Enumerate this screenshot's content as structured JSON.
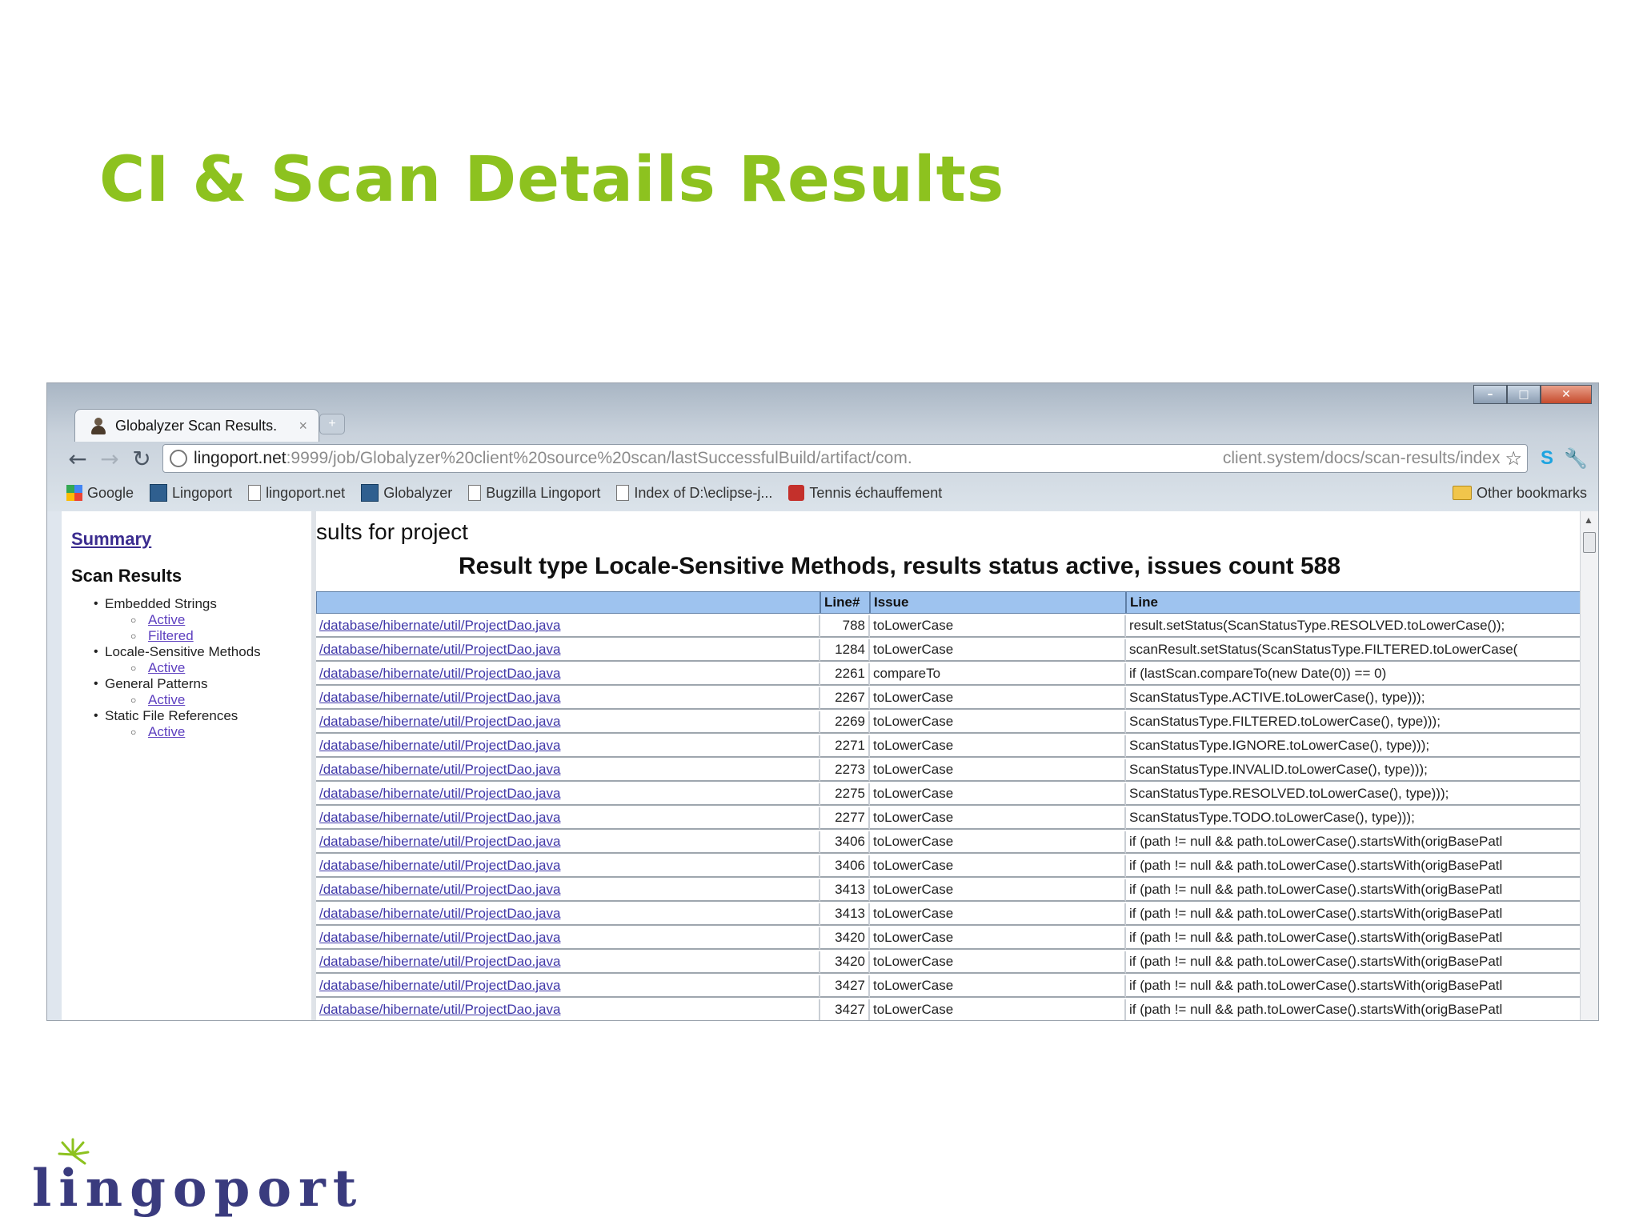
{
  "slide": {
    "title": "CI & Scan Details Results"
  },
  "browser": {
    "tab_title": "Globalyzer Scan Results.",
    "tab_close": "×",
    "new_tab": "+",
    "url_host": "lingoport.net",
    "url_path": ":9999/job/Globalyzer%20client%20source%20scan/lastSuccessfulBuild/artifact/com.",
    "url_tail": "client.system/docs/scan-results/index",
    "bookmarks": [
      {
        "label": "Google",
        "icon": "google-icon"
      },
      {
        "label": "Lingoport",
        "icon": "globalyzer-icon"
      },
      {
        "label": "lingoport.net",
        "icon": "page-icon"
      },
      {
        "label": "Globalyzer",
        "icon": "globalyzer-icon"
      },
      {
        "label": "Bugzilla Lingoport",
        "icon": "page-icon"
      },
      {
        "label": "Index of D:\\eclipse-j...",
        "icon": "page-icon"
      },
      {
        "label": "Tennis échauffement",
        "icon": "youtube-icon"
      }
    ],
    "other_bookmarks": "Other bookmarks"
  },
  "sidebar": {
    "summary": "Summary",
    "heading": "Scan Results",
    "categories": [
      {
        "label": "Embedded Strings",
        "links": [
          "Active",
          "Filtered"
        ]
      },
      {
        "label": "Locale-Sensitive Methods",
        "links": [
          "Active"
        ]
      },
      {
        "label": "General Patterns",
        "links": [
          "Active"
        ]
      },
      {
        "label": "Static File References",
        "links": [
          "Active"
        ]
      }
    ]
  },
  "main": {
    "results_for": "sults for project",
    "result_type": "Result type Locale-Sensitive Methods, results status active, issues count 588",
    "columns": [
      "",
      "Line#",
      "Issue",
      "Line"
    ],
    "rows": [
      {
        "file": "/database/hibernate/util/ProjectDao.java",
        "line": "788",
        "issue": "toLowerCase",
        "code": "result.setStatus(ScanStatusType.RESOLVED.toLowerCase());"
      },
      {
        "file": "/database/hibernate/util/ProjectDao.java",
        "line": "1284",
        "issue": "toLowerCase",
        "code": "scanResult.setStatus(ScanStatusType.FILTERED.toLowerCase("
      },
      {
        "file": "/database/hibernate/util/ProjectDao.java",
        "line": "2261",
        "issue": "compareTo",
        "code": "if (lastScan.compareTo(new Date(0)) == 0)"
      },
      {
        "file": "/database/hibernate/util/ProjectDao.java",
        "line": "2267",
        "issue": "toLowerCase",
        "code": "ScanStatusType.ACTIVE.toLowerCase(), type)));"
      },
      {
        "file": "/database/hibernate/util/ProjectDao.java",
        "line": "2269",
        "issue": "toLowerCase",
        "code": "ScanStatusType.FILTERED.toLowerCase(), type)));"
      },
      {
        "file": "/database/hibernate/util/ProjectDao.java",
        "line": "2271",
        "issue": "toLowerCase",
        "code": "ScanStatusType.IGNORE.toLowerCase(), type)));"
      },
      {
        "file": "/database/hibernate/util/ProjectDao.java",
        "line": "2273",
        "issue": "toLowerCase",
        "code": "ScanStatusType.INVALID.toLowerCase(), type)));"
      },
      {
        "file": "/database/hibernate/util/ProjectDao.java",
        "line": "2275",
        "issue": "toLowerCase",
        "code": "ScanStatusType.RESOLVED.toLowerCase(), type)));"
      },
      {
        "file": "/database/hibernate/util/ProjectDao.java",
        "line": "2277",
        "issue": "toLowerCase",
        "code": "ScanStatusType.TODO.toLowerCase(), type)));"
      },
      {
        "file": "/database/hibernate/util/ProjectDao.java",
        "line": "3406",
        "issue": "toLowerCase",
        "code": "if (path != null && path.toLowerCase().startsWith(origBasePatl"
      },
      {
        "file": "/database/hibernate/util/ProjectDao.java",
        "line": "3406",
        "issue": "toLowerCase",
        "code": "if (path != null && path.toLowerCase().startsWith(origBasePatl"
      },
      {
        "file": "/database/hibernate/util/ProjectDao.java",
        "line": "3413",
        "issue": "toLowerCase",
        "code": "if (path != null && path.toLowerCase().startsWith(origBasePatl"
      },
      {
        "file": "/database/hibernate/util/ProjectDao.java",
        "line": "3413",
        "issue": "toLowerCase",
        "code": "if (path != null && path.toLowerCase().startsWith(origBasePatl"
      },
      {
        "file": "/database/hibernate/util/ProjectDao.java",
        "line": "3420",
        "issue": "toLowerCase",
        "code": "if (path != null && path.toLowerCase().startsWith(origBasePatl"
      },
      {
        "file": "/database/hibernate/util/ProjectDao.java",
        "line": "3420",
        "issue": "toLowerCase",
        "code": "if (path != null && path.toLowerCase().startsWith(origBasePatl"
      },
      {
        "file": "/database/hibernate/util/ProjectDao.java",
        "line": "3427",
        "issue": "toLowerCase",
        "code": "if (path != null && path.toLowerCase().startsWith(origBasePatl"
      },
      {
        "file": "/database/hibernate/util/ProjectDao.java",
        "line": "3427",
        "issue": "toLowerCase",
        "code": "if (path != null && path.toLowerCase().startsWith(origBasePatl"
      }
    ]
  },
  "logo": {
    "text": "lingoport"
  },
  "colors": {
    "title_green": "#8dc21f",
    "logo_navy": "#3a3b7e",
    "header_blue": "#9ec3ef"
  }
}
